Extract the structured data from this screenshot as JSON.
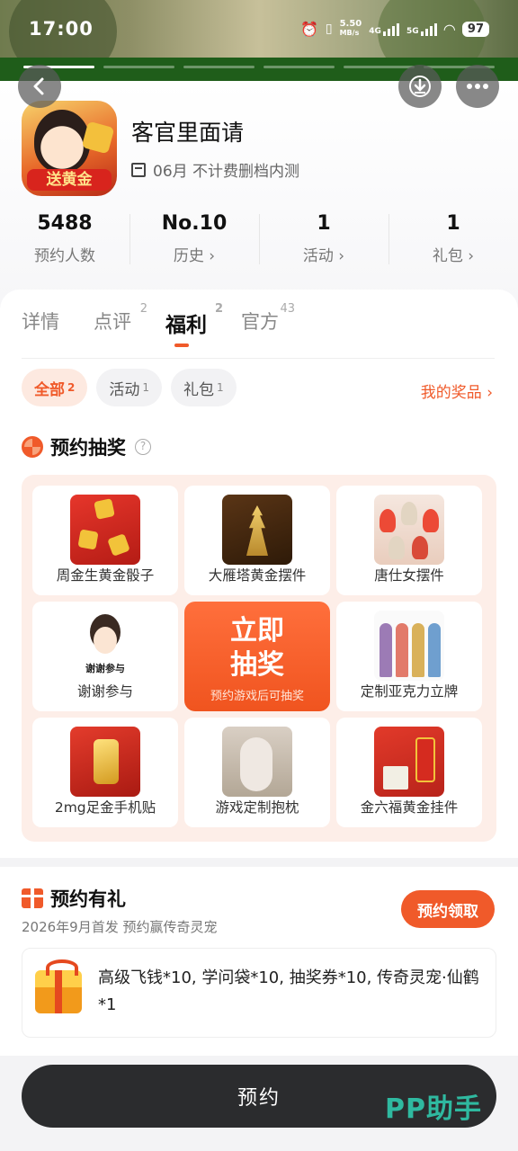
{
  "status_bar": {
    "time": "17:00",
    "net_speed": "5.50",
    "net_unit": "MB/s",
    "signal_1": "4G",
    "signal_2": "5G",
    "battery": "97"
  },
  "header": {
    "app_name": "客官里面请",
    "app_icon_text": "送黄金",
    "subtitle": "06月 不计费删档内测",
    "stats": [
      {
        "value": "5488",
        "label": "预约人数"
      },
      {
        "value": "No.10",
        "label": "历史 ›"
      },
      {
        "value": "1",
        "label": "活动 ›"
      },
      {
        "value": "1",
        "label": "礼包 ›"
      }
    ]
  },
  "tabs": [
    {
      "label": "详情",
      "count": ""
    },
    {
      "label": "点评",
      "count": "2"
    },
    {
      "label": "福利",
      "count": "2"
    },
    {
      "label": "官方",
      "count": "43"
    }
  ],
  "filters": [
    {
      "label": "全部",
      "count": "2"
    },
    {
      "label": "活动",
      "count": "1"
    },
    {
      "label": "礼包",
      "count": "1"
    }
  ],
  "my_prizes": "我的奖品 ›",
  "lottery": {
    "title": "预约抽奖",
    "help": "?",
    "prizes": [
      "周金生黄金骰子",
      "大雁塔黄金摆件",
      "唐仕女摆件",
      "谢谢参与",
      "定制亚克力立牌",
      "2mg足金手机贴",
      "游戏定制抱枕",
      "金六福黄金挂件"
    ],
    "thanks_thumb_text": "谢谢参与",
    "draw_main": "立即\n抽奖",
    "draw_line1": "立即",
    "draw_line2": "抽奖",
    "draw_sub": "预约游戏后可抽奖"
  },
  "gift": {
    "title": "预约有礼",
    "subtitle": "2026年9月首发 预约赢传奇灵宠",
    "claim_label": "预约领取",
    "rewards": "高级飞钱*10, 学问袋*10, 抽奖券*10, 传奇灵宠·仙鹤*1"
  },
  "bottom": {
    "reserve_label": "预约",
    "watermark": "PP助手"
  },
  "colors": {
    "accent": "#f05a2a",
    "dark_button": "#2b2c2e",
    "watermark": "#2fb9a0"
  }
}
